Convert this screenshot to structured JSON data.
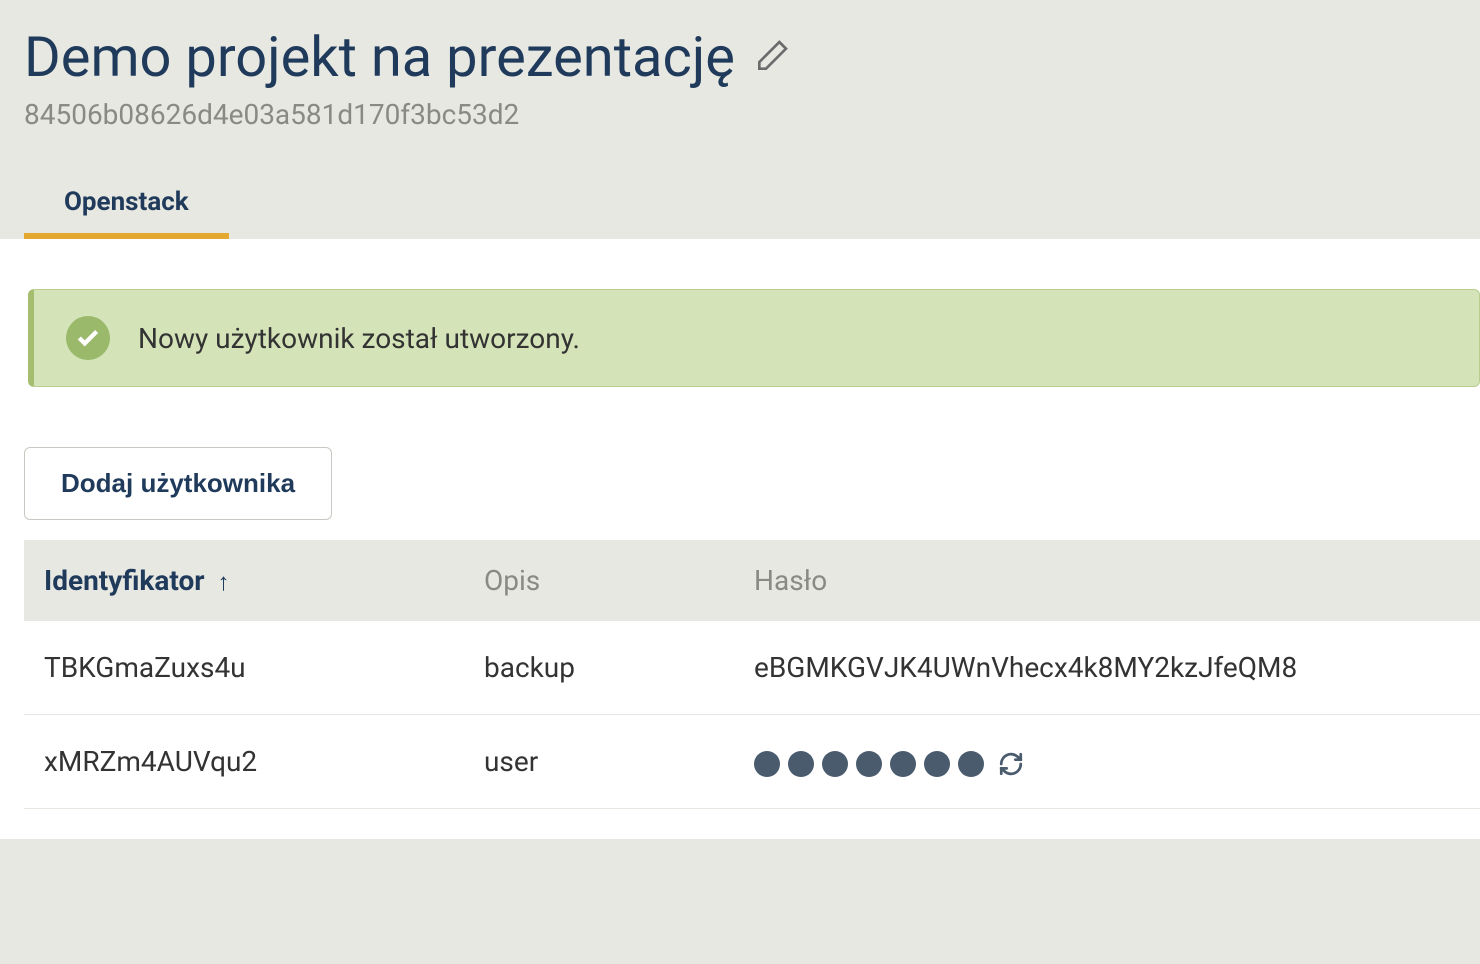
{
  "header": {
    "title": "Demo projekt na prezentację",
    "project_id": "84506b08626d4e03a581d170f3bc53d2"
  },
  "tabs": [
    {
      "label": "Openstack",
      "active": true
    }
  ],
  "alert": {
    "message": "Nowy użytkownik został utworzony."
  },
  "actions": {
    "add_user_label": "Dodaj użytkownika"
  },
  "table": {
    "columns": {
      "id": "Identyfikator",
      "desc": "Opis",
      "password": "Hasło"
    },
    "sort_indicator": "↑",
    "rows": [
      {
        "id": "TBKGmaZuxs4u",
        "desc": "backup",
        "password": "eBGMKGVJK4UWnVhecx4k8MY2kzJfeQM8",
        "masked": false
      },
      {
        "id": "xMRZm4AUVqu2",
        "desc": "user",
        "password": "",
        "masked": true,
        "mask_dots": 7
      }
    ]
  }
}
